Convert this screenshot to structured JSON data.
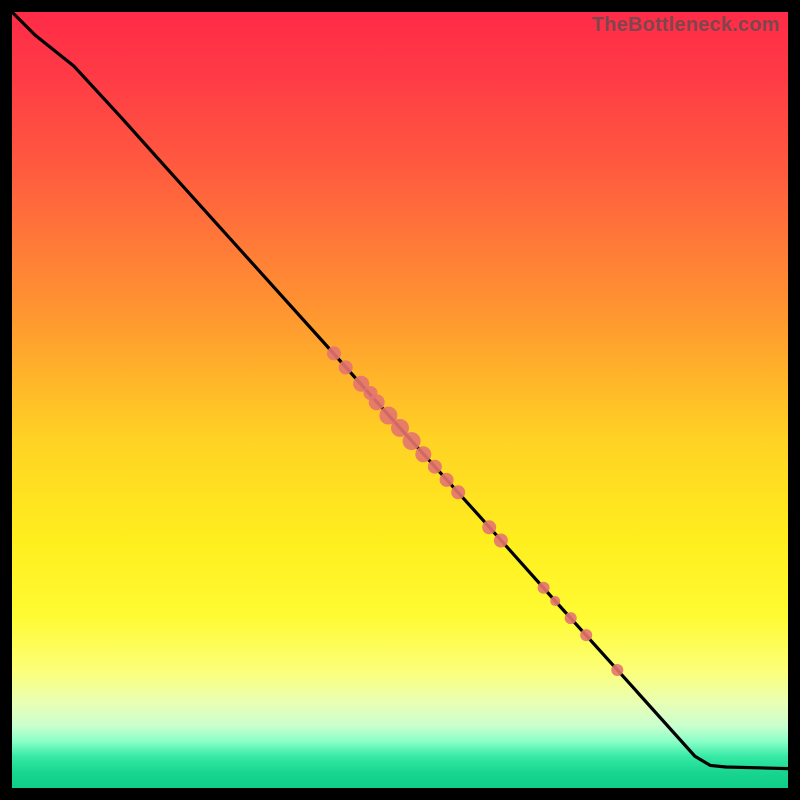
{
  "attribution": "TheBottleneck.com",
  "chart_data": {
    "type": "line",
    "title": "",
    "xlabel": "",
    "ylabel": "",
    "xlim": [
      0,
      100
    ],
    "ylim": [
      0,
      100
    ],
    "curve": [
      {
        "x": 0,
        "y": 100
      },
      {
        "x": 3,
        "y": 97
      },
      {
        "x": 8,
        "y": 93
      },
      {
        "x": 14,
        "y": 86.5
      },
      {
        "x": 20,
        "y": 79.8
      },
      {
        "x": 30,
        "y": 68.7
      },
      {
        "x": 40,
        "y": 57.6
      },
      {
        "x": 50,
        "y": 46.4
      },
      {
        "x": 60,
        "y": 35.3
      },
      {
        "x": 70,
        "y": 24.1
      },
      {
        "x": 80,
        "y": 13.0
      },
      {
        "x": 88,
        "y": 4.1
      },
      {
        "x": 90,
        "y": 2.9
      },
      {
        "x": 92,
        "y": 2.7
      },
      {
        "x": 100,
        "y": 2.5
      }
    ],
    "points": [
      {
        "x": 41.5,
        "y": 56.0,
        "r": 7
      },
      {
        "x": 43.0,
        "y": 54.2,
        "r": 7
      },
      {
        "x": 45.0,
        "y": 52.1,
        "r": 8
      },
      {
        "x": 46.2,
        "y": 50.9,
        "r": 7
      },
      {
        "x": 47.0,
        "y": 49.7,
        "r": 8
      },
      {
        "x": 48.5,
        "y": 48.0,
        "r": 9
      },
      {
        "x": 50.0,
        "y": 46.4,
        "r": 9
      },
      {
        "x": 51.5,
        "y": 44.7,
        "r": 9
      },
      {
        "x": 53.0,
        "y": 43.0,
        "r": 8
      },
      {
        "x": 54.5,
        "y": 41.4,
        "r": 7
      },
      {
        "x": 56.0,
        "y": 39.7,
        "r": 7
      },
      {
        "x": 57.5,
        "y": 38.1,
        "r": 7
      },
      {
        "x": 61.5,
        "y": 33.6,
        "r": 7
      },
      {
        "x": 63.0,
        "y": 31.9,
        "r": 7
      },
      {
        "x": 68.5,
        "y": 25.8,
        "r": 6
      },
      {
        "x": 70.0,
        "y": 24.1,
        "r": 5
      },
      {
        "x": 72.0,
        "y": 21.9,
        "r": 6
      },
      {
        "x": 74.0,
        "y": 19.7,
        "r": 6
      },
      {
        "x": 78.0,
        "y": 15.2,
        "r": 6
      }
    ]
  }
}
